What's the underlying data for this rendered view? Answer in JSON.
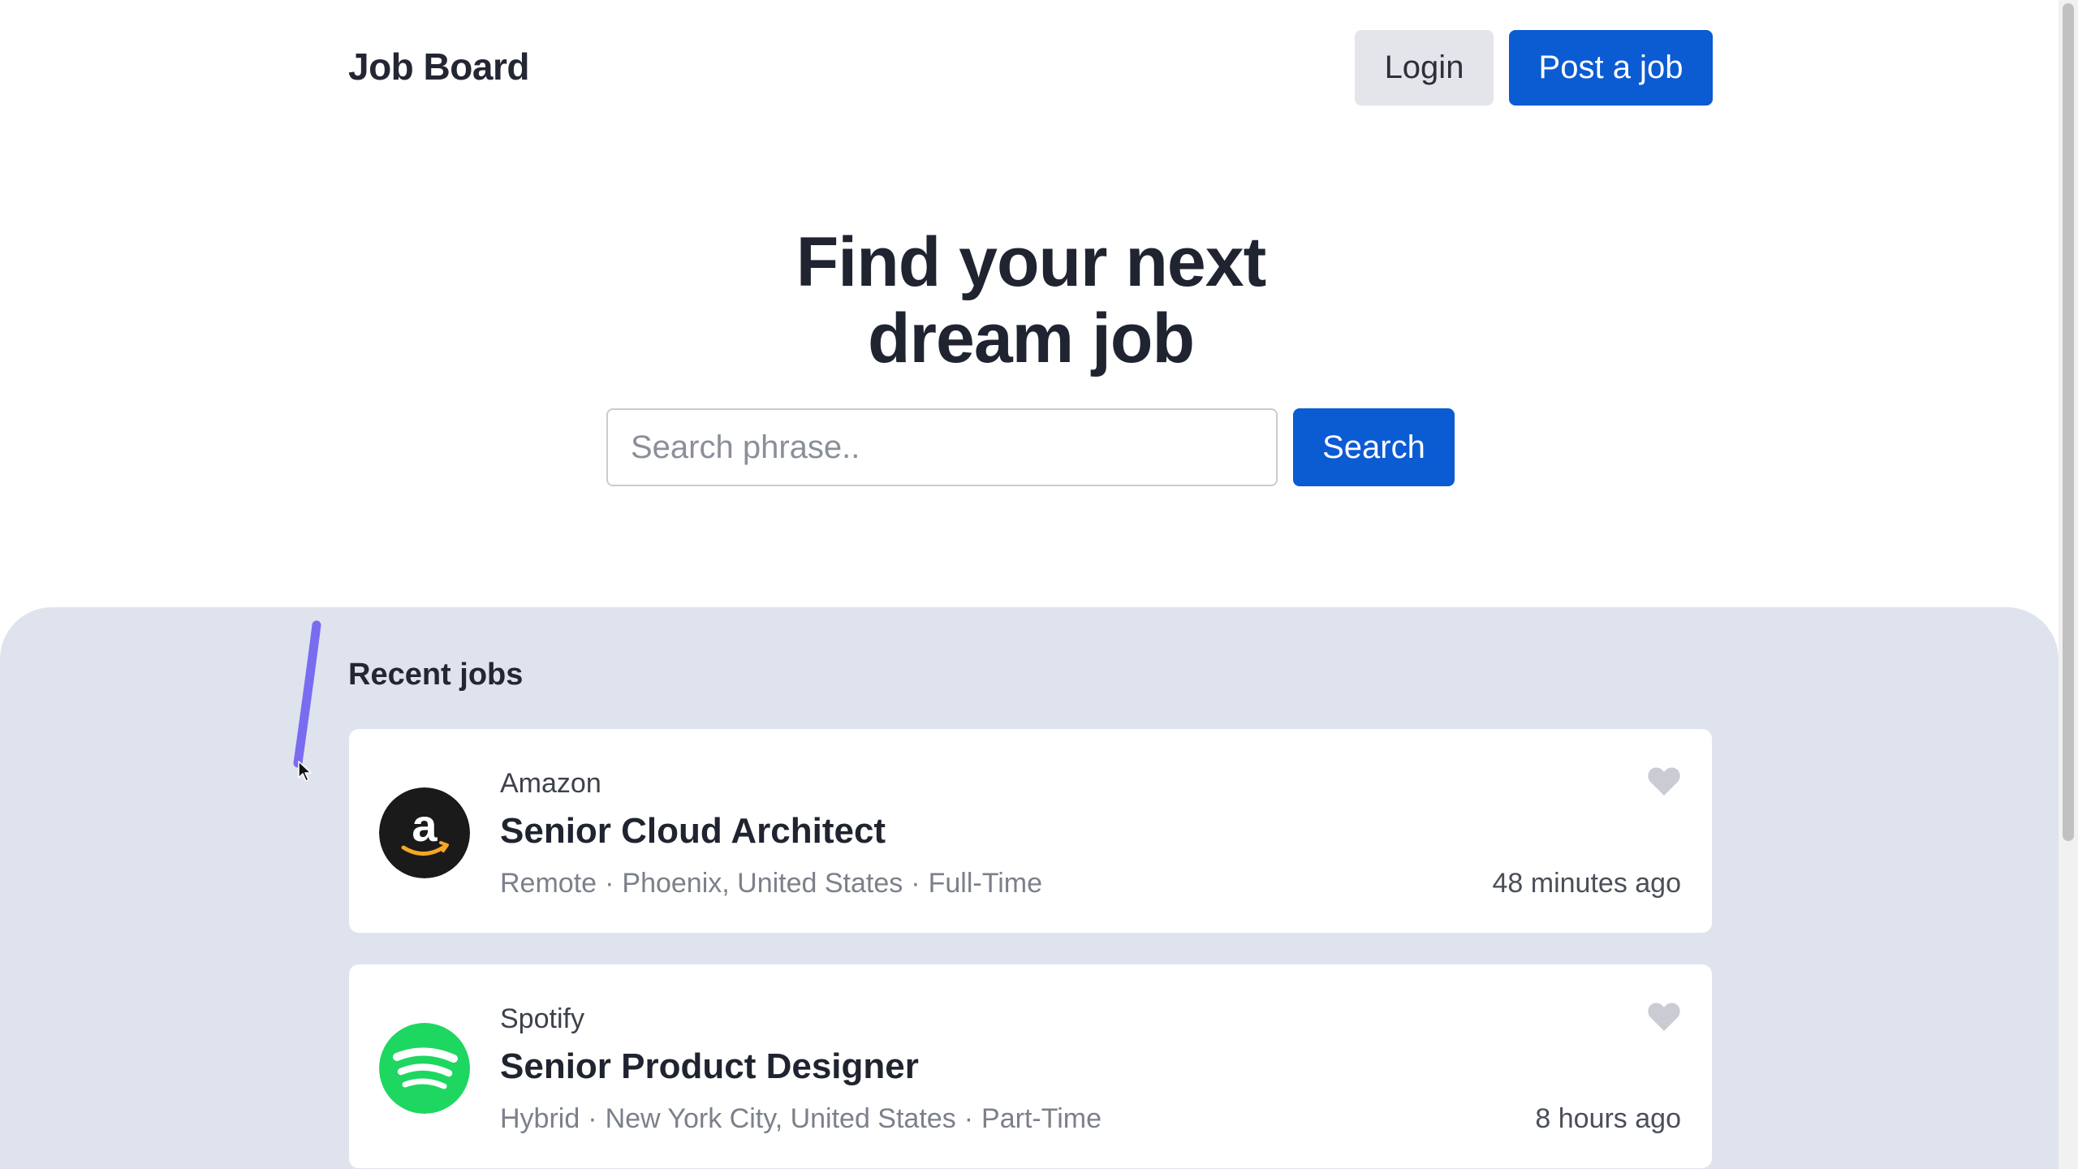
{
  "header": {
    "brand": "Job Board",
    "login_label": "Login",
    "post_job_label": "Post a job"
  },
  "hero": {
    "title_line1": "Find your next",
    "title_line2": "dream job",
    "search_placeholder": "Search phrase..",
    "search_value": "",
    "search_button_label": "Search"
  },
  "recent": {
    "heading": "Recent jobs",
    "jobs": [
      {
        "company": "Amazon",
        "logo_icon": "amazon-logo",
        "title": "Senior Cloud Architect",
        "work_mode": "Remote",
        "location": "Phoenix, United States",
        "employment_type": "Full-Time",
        "posted": "48 minutes ago",
        "favorite_icon": "heart-icon"
      },
      {
        "company": "Spotify",
        "logo_icon": "spotify-logo",
        "title": "Senior Product Designer",
        "work_mode": "Hybrid",
        "location": "New York City, United States",
        "employment_type": "Part-Time",
        "posted": "8 hours ago",
        "favorite_icon": "heart-icon"
      }
    ]
  },
  "colors": {
    "primary": "#0b5bd3",
    "secondary_button": "#e3e5ea",
    "section_background": "#dfe3ed",
    "spotify_green": "#1ed760",
    "amazon_orange": "#f5a623",
    "heart": "#c9ccd3",
    "annotation_stroke": "#7a6cf0"
  }
}
